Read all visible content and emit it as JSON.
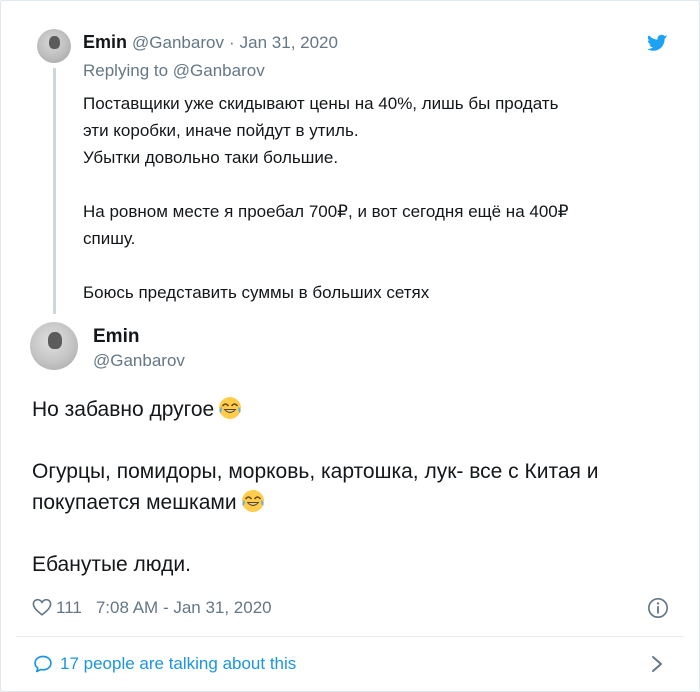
{
  "parent_tweet": {
    "name": "Emin",
    "handle": "@Ganbarov",
    "separator": "·",
    "date": "Jan 31, 2020",
    "replying_prefix": "Replying to ",
    "replying_to": "@Ganbarov",
    "lines": [
      "Поставщики уже скидывают цены на 40%, лишь бы продать",
      "эти коробки, иначе пойдут в утиль.",
      "Убытки довольно таки большие.",
      "",
      "На ровном месте я проебал 700₽, и вот сегодня ещё на 400₽",
      "спишу.",
      "",
      "Боюсь представить суммы в больших сетях"
    ],
    "icon": "twitter-bird-icon"
  },
  "main_tweet": {
    "name": "Emin",
    "handle": "@Ganbarov",
    "line1": "Но забавно другое",
    "line2": "Огурцы, помидоры, морковь, картошка, лук- все с Китая и",
    "line3": "покупается мешками",
    "line4": "Ебанутые люди.",
    "emoji": "tears-of-joy-emoji"
  },
  "meta": {
    "like_count": "111",
    "time": "7:08 AM - Jan 31, 2020",
    "icons": [
      "heart-icon",
      "info-icon"
    ]
  },
  "footer": {
    "talking_text": "17 people are talking about this",
    "icons": [
      "speech-bubble-icon",
      "chevron-right-icon"
    ]
  },
  "colors": {
    "text": "#14171a",
    "secondary": "#657786",
    "link": "#1b95e0",
    "twitter_blue": "#1da1f2",
    "divider": "#e6ecf0"
  }
}
